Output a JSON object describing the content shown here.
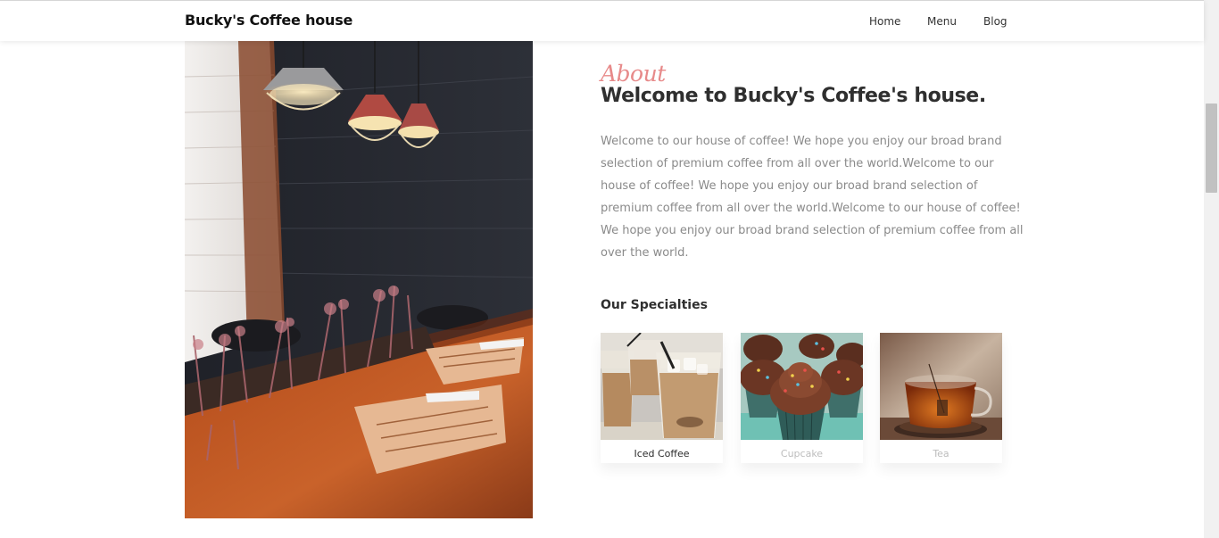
{
  "header": {
    "brand": "Bucky's Coffee house",
    "nav": [
      "Home",
      "Menu",
      "Blog"
    ]
  },
  "about": {
    "script_label": "About",
    "title": "Welcome to Bucky's Coffee's house.",
    "body": "Welcome to our house of coffee! We hope you enjoy our broad brand selection of premium coffee from all over the world.Welcome to our house of coffee! We hope you enjoy our broad brand selection of premium coffee from all over the world.Welcome to our house of coffee! We hope you enjoy our broad brand selection of premium coffee from all over the world."
  },
  "specialties": {
    "title": "Our Specialties",
    "items": [
      {
        "label": "Iced Coffee",
        "active": true
      },
      {
        "label": "Cupcake",
        "active": false
      },
      {
        "label": "Tea",
        "active": false
      }
    ]
  },
  "colors": {
    "accent_script": "#e78a8a",
    "heading": "#2f2f2f",
    "body_text": "#8a8a8a",
    "muted_label": "#bdbdbd"
  }
}
